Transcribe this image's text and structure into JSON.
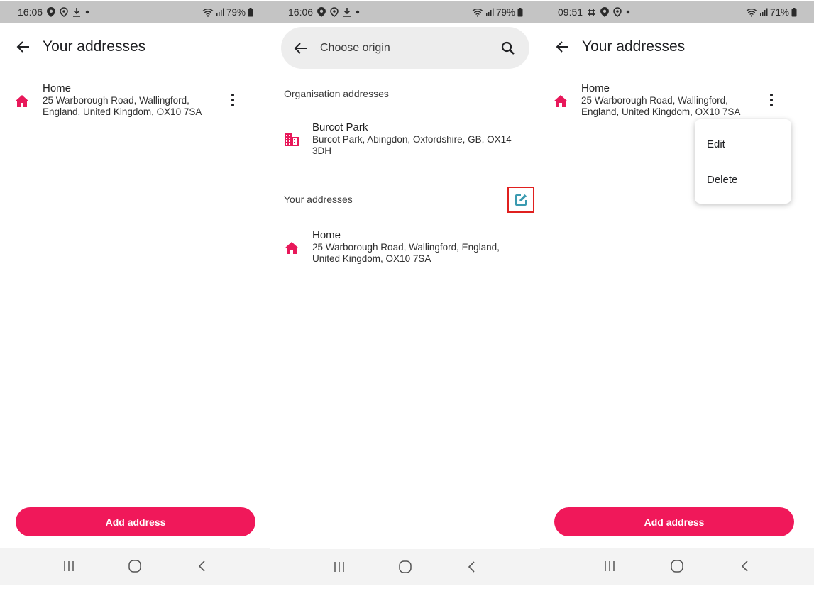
{
  "colors": {
    "accent": "#f0185a",
    "edit_icon": "#3a9ab0",
    "highlight_border": "#e0201f"
  },
  "screens": [
    {
      "status": {
        "time": "16:06",
        "battery": "79%",
        "icons": [
          "location-icon",
          "location-outline-icon",
          "download-icon",
          "dot-icon"
        ]
      },
      "appbar": {
        "title": "Your addresses"
      },
      "addresses": [
        {
          "name": "Home",
          "line1": "25 Warborough Road, Wallingford,",
          "line2": "England, United Kingdom, OX10 7SA",
          "icon": "home-icon"
        }
      ],
      "add_button": "Add address"
    },
    {
      "status": {
        "time": "16:06",
        "battery": "79%",
        "icons": [
          "location-icon",
          "location-outline-icon",
          "download-icon",
          "dot-icon"
        ]
      },
      "search": {
        "placeholder": "Choose origin"
      },
      "organisation_header": "Organisation addresses",
      "organisation_addresses": [
        {
          "name": "Burcot Park",
          "line1": "Burcot Park, Abingdon, Oxfordshire, GB, OX14",
          "line2": "3DH",
          "icon": "building-icon"
        }
      ],
      "your_header": "Your addresses",
      "your_addresses": [
        {
          "name": "Home",
          "line1": "25 Warborough Road, Wallingford, England,",
          "line2": "United Kingdom, OX10 7SA",
          "icon": "home-icon"
        }
      ]
    },
    {
      "status": {
        "time": "09:51",
        "battery": "71%",
        "icons": [
          "slack-icon",
          "location-icon",
          "location-outline-icon",
          "dot-icon"
        ]
      },
      "appbar": {
        "title": "Your addresses"
      },
      "addresses": [
        {
          "name": "Home",
          "line1": "25 Warborough Road, Wallingford,",
          "line2": "England, United Kingdom, OX10 7SA",
          "icon": "home-icon"
        }
      ],
      "menu": {
        "items": [
          "Edit",
          "Delete"
        ]
      },
      "add_button": "Add address"
    }
  ]
}
